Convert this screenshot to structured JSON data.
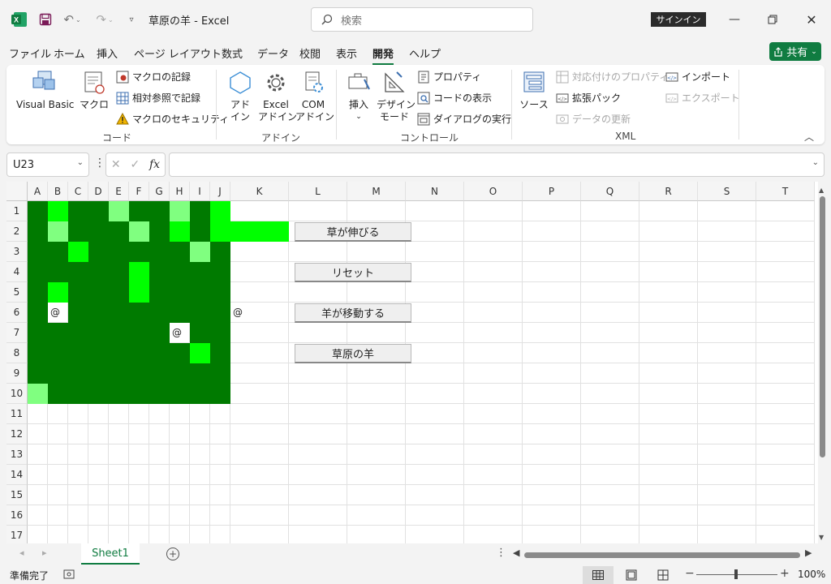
{
  "titlebar": {
    "title": "草原の羊  -  Excel",
    "search_placeholder": "検索",
    "signin": "サインイン"
  },
  "menu": {
    "tabs": [
      "ファイル",
      "ホーム",
      "挿入",
      "ページ レイアウト",
      "数式",
      "データ",
      "校閲",
      "表示",
      "開発",
      "ヘルプ"
    ],
    "active": "開発",
    "share": "共有"
  },
  "ribbon": {
    "code": {
      "label": "コード",
      "visual_basic": "Visual Basic",
      "macro": "マクロ",
      "record_macro": "マクロの記録",
      "relative_ref": "相対参照で記録",
      "macro_security": "マクロのセキュリティ"
    },
    "addin": {
      "label": "アドイン",
      "addin_line1": "アド",
      "addin_line2": "イン",
      "excel_addin_line1": "Excel",
      "excel_addin_line2": "アドイン",
      "com_addin_line1": "COM",
      "com_addin_line2": "アドイン"
    },
    "controls": {
      "label": "コントロール",
      "insert": "挿入",
      "design_mode_line1": "デザイン",
      "design_mode_line2": "モード",
      "properties": "プロパティ",
      "view_code": "コードの表示",
      "run_dialog": "ダイアログの実行"
    },
    "xml": {
      "label": "XML",
      "source": "ソース",
      "map_properties": "対応付けのプロパティ",
      "expansion_packs": "拡張パック",
      "refresh_data": "データの更新",
      "import": "インポート",
      "export": "エクスポート"
    }
  },
  "formula_bar": {
    "name_box": "U23",
    "formula": "",
    "fx": "fx"
  },
  "grid": {
    "columns": [
      "A",
      "B",
      "C",
      "D",
      "E",
      "F",
      "G",
      "H",
      "I",
      "J",
      "K",
      "L",
      "M",
      "N",
      "O",
      "P",
      "Q",
      "R",
      "S",
      "T"
    ],
    "rows": [
      "1",
      "2",
      "3",
      "4",
      "5",
      "6",
      "7",
      "8",
      "9",
      "10",
      "11",
      "12",
      "13",
      "14",
      "15",
      "16",
      "17"
    ],
    "field": [
      "dgddlddldg",
      "dldddldgdgg",
      "ddgdddddld",
      "dddddgdddd",
      "dgdddgdddd",
      "dwddddddddw",
      "dddddddwdd",
      "ddddddddgd",
      "dddddddddd",
      "lddddddddd"
    ],
    "sheep_text": "@",
    "buttons": [
      "草が伸びる",
      "リセット",
      "羊が移動する",
      "草原の羊"
    ]
  },
  "colors": {
    "dark_green": "#007a00",
    "bright_green": "#00ff00",
    "light_green": "#80ff80",
    "accent": "#107c41"
  },
  "sheets": {
    "active": "Sheet1"
  },
  "status": {
    "text": "準備完了",
    "zoom": "100%"
  }
}
